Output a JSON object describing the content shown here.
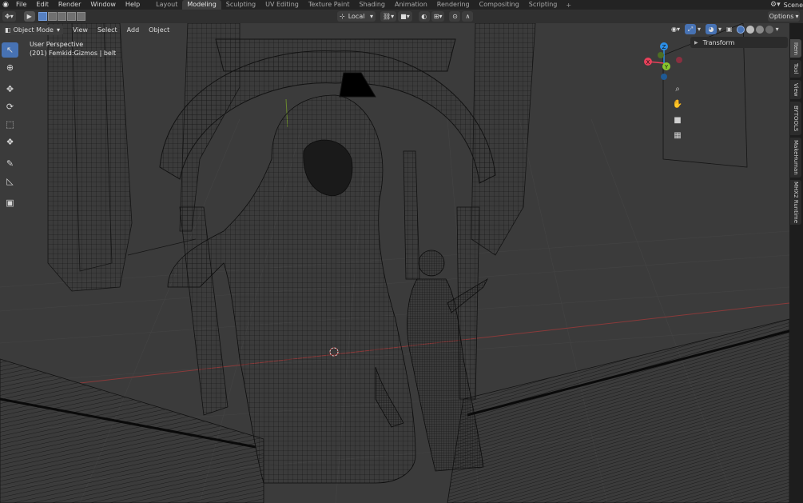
{
  "menu": [
    "File",
    "Edit",
    "Render",
    "Window",
    "Help"
  ],
  "workspaces": [
    {
      "label": "Layout",
      "active": false
    },
    {
      "label": "Modeling",
      "active": true
    },
    {
      "label": "Sculpting",
      "active": false
    },
    {
      "label": "UV Editing",
      "active": false
    },
    {
      "label": "Texture Paint",
      "active": false
    },
    {
      "label": "Shading",
      "active": false
    },
    {
      "label": "Animation",
      "active": false
    },
    {
      "label": "Rendering",
      "active": false
    },
    {
      "label": "Compositing",
      "active": false
    },
    {
      "label": "Scripting",
      "active": false
    }
  ],
  "add_workspace": "+",
  "scene_label": "Scene",
  "header": {
    "orientation": "Local",
    "options": "Options"
  },
  "viewport": {
    "mode": "Object Mode",
    "menu": [
      "View",
      "Select",
      "Add",
      "Object"
    ],
    "perspective": "User Perspective",
    "object_info": "(201) Femkid:Gizmos | belt"
  },
  "gizmo": {
    "x": "X",
    "y": "Y",
    "z": "Z"
  },
  "sidebar": {
    "panel": "Transform",
    "tabs": [
      {
        "label": "Item",
        "active": true
      },
      {
        "label": "Tool",
        "active": false
      },
      {
        "label": "View",
        "active": false
      },
      {
        "label": "BYTOOLS",
        "active": false
      },
      {
        "label": "MakeHuman",
        "active": false
      },
      {
        "label": "MHX2 Runtime",
        "active": false
      }
    ]
  },
  "colors": {
    "accent": "#4772b3",
    "axis_x": "#e8405a",
    "axis_y": "#8ac72d",
    "axis_z": "#2c8fe8",
    "viewport_bg": "#3b3b3b",
    "wire": "#0d0d0d"
  }
}
